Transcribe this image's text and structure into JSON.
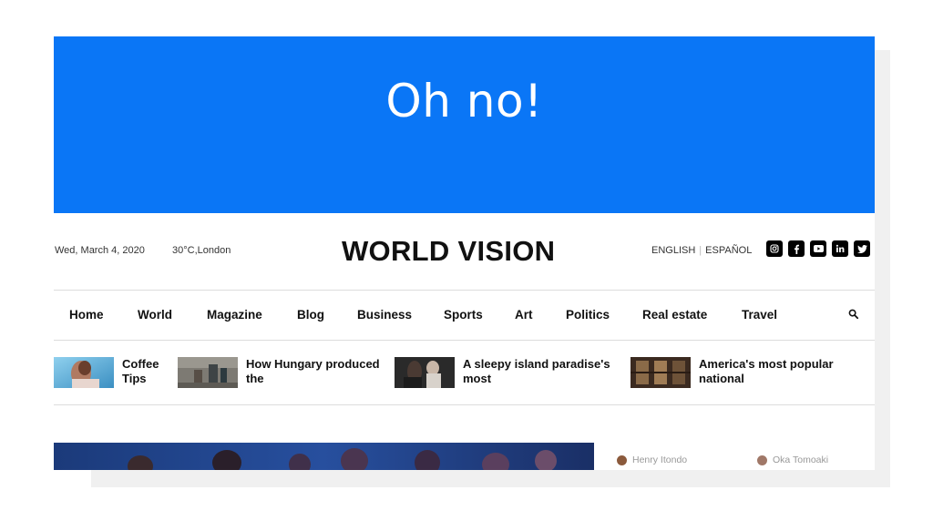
{
  "banner": {
    "heading": "Oh no!"
  },
  "header": {
    "date": "Wed, March 4, 2020",
    "weather": "30°C,London",
    "logo": "WORLD VISION",
    "languages": [
      "ENGLISH",
      "ESPAÑOL"
    ],
    "socials": [
      "instagram-icon",
      "facebook-icon",
      "youtube-icon",
      "linkedin-icon",
      "twitter-icon"
    ]
  },
  "nav": {
    "items": [
      "Home",
      "World",
      "Magazine",
      "Blog",
      "Business",
      "Sports",
      "Art",
      "Politics",
      "Real estate",
      "Travel"
    ]
  },
  "trending": [
    {
      "title": "Coffee\nTips"
    },
    {
      "title": "How Hungary produced\nthe"
    },
    {
      "title": "A sleepy island paradise's\nmost"
    },
    {
      "title": "America's most popular\nnational"
    }
  ],
  "authors": [
    "Henry Itondo",
    "Oka Tomoaki"
  ],
  "colors": {
    "banner": "#0a76f6",
    "text": "#111111",
    "rule": "#dcdcdc"
  }
}
